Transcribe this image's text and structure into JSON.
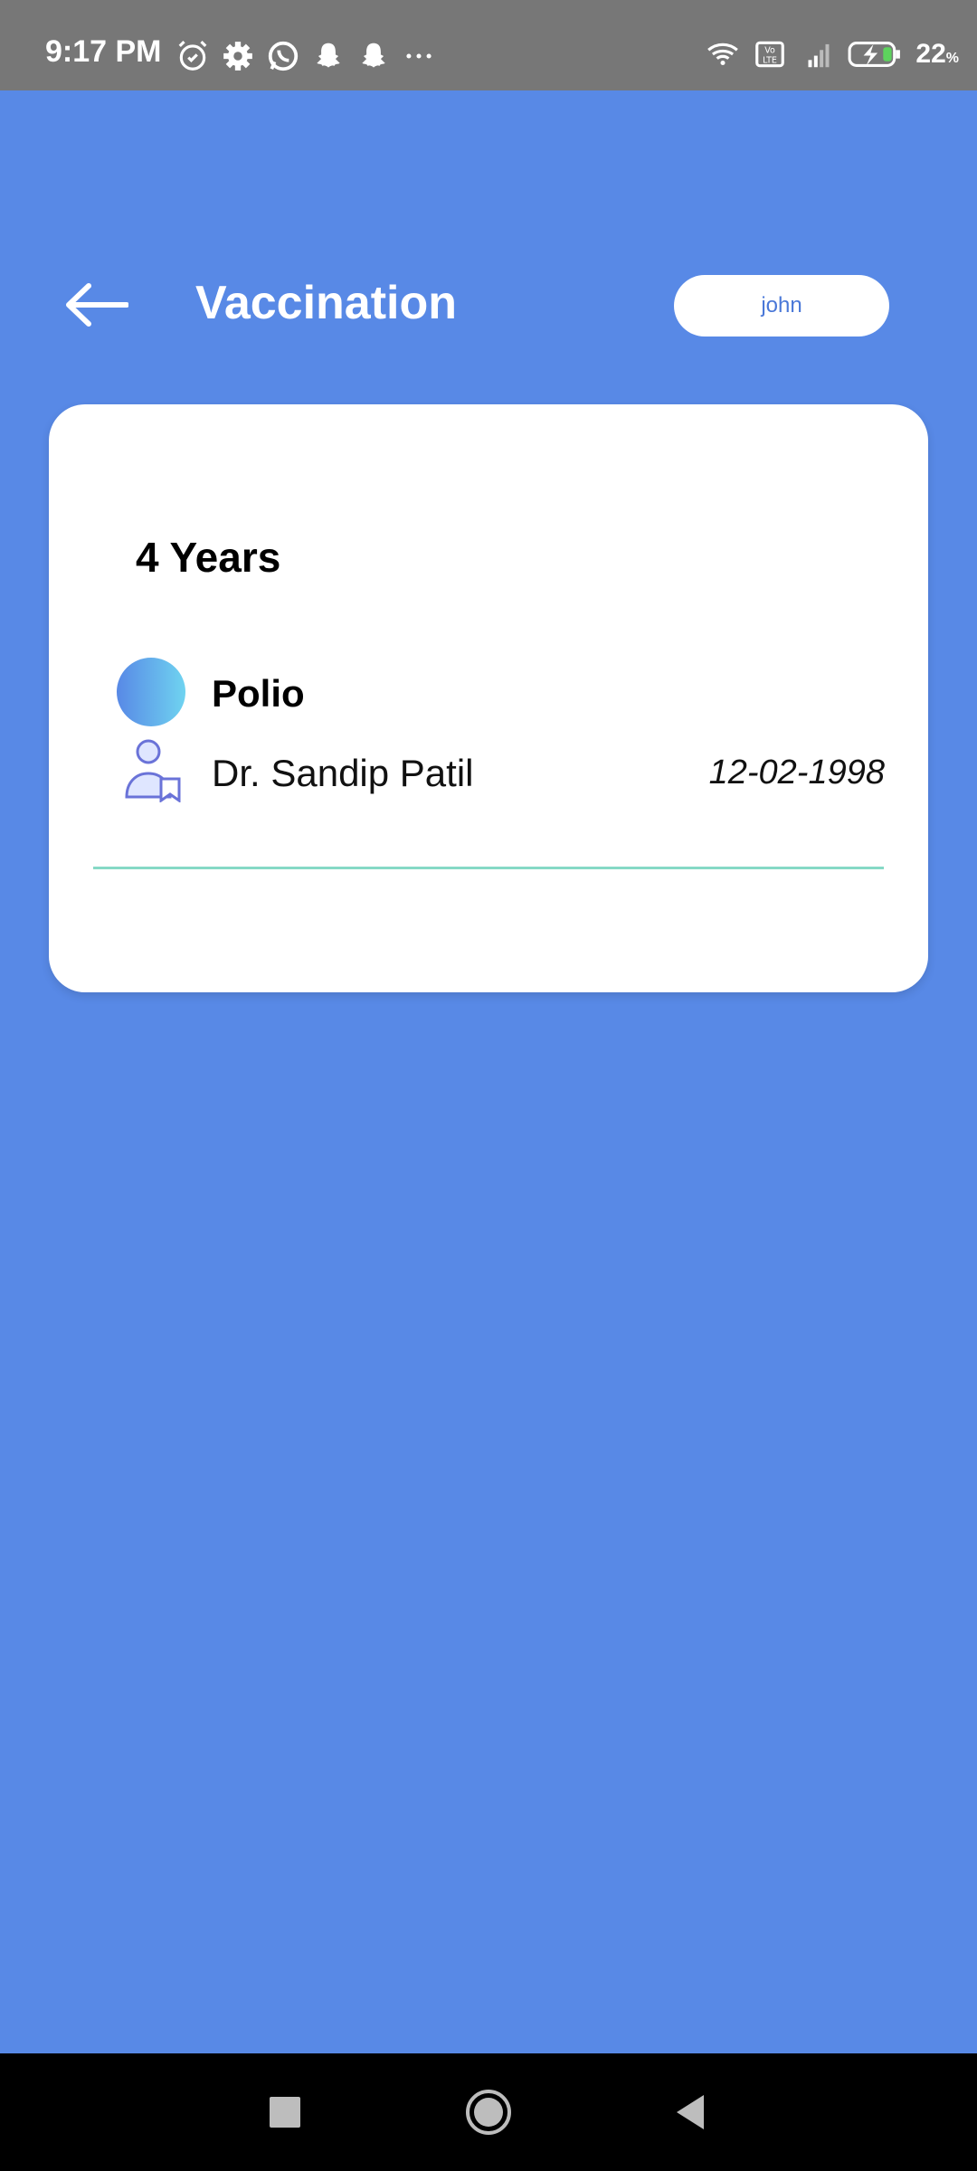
{
  "status_bar": {
    "time": "9:17 PM",
    "left_icons": [
      "alarm-icon",
      "gear-icon",
      "whatsapp-icon",
      "snapchat-icon",
      "snapchat-icon",
      "more-icon"
    ],
    "right_icons": [
      "wifi-icon",
      "volte-icon",
      "signal-4g-icon",
      "battery-charging-icon"
    ],
    "battery_percent": "22",
    "battery_unit": "%"
  },
  "header": {
    "title": "Vaccination",
    "back_icon": "arrow-left-icon",
    "user_label": "john"
  },
  "card": {
    "age_group": "4 Years",
    "vaccine": {
      "name": "Polio",
      "doctor": "Dr. Sandip Patil",
      "date": "12-02-1998"
    },
    "colors": {
      "dot_start": "#5889e6",
      "dot_end": "#6fd3f0",
      "divider": "#86d9c6"
    }
  },
  "nav_bar": {
    "buttons": [
      "recents-square-icon",
      "home-circle-icon",
      "back-triangle-icon"
    ]
  },
  "colors": {
    "background": "#5889e6",
    "status_bar": "#777777",
    "accent_text": "#4a78d8"
  }
}
